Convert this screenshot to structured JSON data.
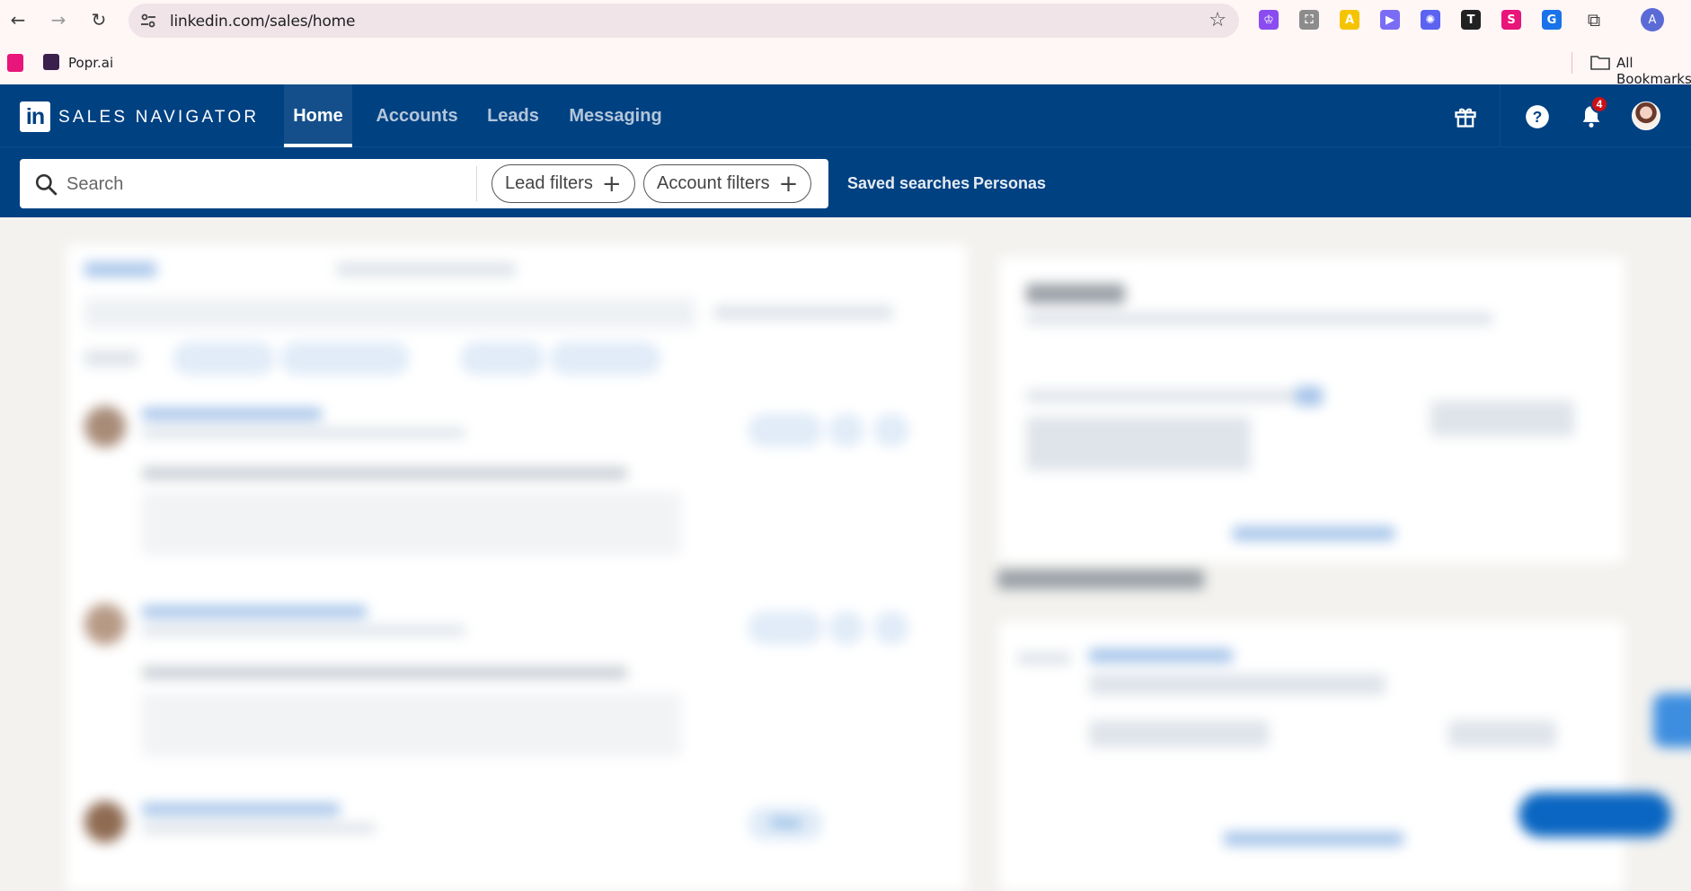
{
  "browser": {
    "url": "linkedin.com/sales/home",
    "bookmarks": [
      {
        "label": ""
      },
      {
        "label": "Popr.ai"
      }
    ],
    "all_bookmarks_label": "All Bookmarks",
    "profile_initial": "A",
    "extensions": [
      {
        "name": "purple-ext-icon",
        "color": "#8a4cf0",
        "glyph": "♔"
      },
      {
        "name": "gray-ext-icon",
        "color": "#8c8c8c",
        "glyph": "⛶"
      },
      {
        "name": "yellow-ext-icon",
        "color": "#f5c400",
        "glyph": "A"
      },
      {
        "name": "violet-ext-icon",
        "color": "#7b6cf5",
        "glyph": "▶"
      },
      {
        "name": "blue-burst-ext-icon",
        "color": "#5b63f0",
        "glyph": "✺"
      },
      {
        "name": "black-t-ext-icon",
        "color": "#222222",
        "glyph": "T"
      },
      {
        "name": "pink-ext-icon",
        "color": "#e8157a",
        "glyph": "S"
      },
      {
        "name": "blue-ext-icon",
        "color": "#1a73e8",
        "glyph": "G"
      }
    ]
  },
  "sales_navigator": {
    "brand": "SALES NAVIGATOR",
    "logo_text": "in",
    "nav": [
      {
        "label": "Home",
        "active": true
      },
      {
        "label": "Accounts",
        "active": false
      },
      {
        "label": "Leads",
        "active": false
      },
      {
        "label": "Messaging",
        "active": false
      }
    ],
    "notification_count": "4",
    "search": {
      "placeholder": "Search",
      "lead_filters_label": "Lead filters",
      "account_filters_label": "Account filters"
    },
    "links": {
      "saved_searches": "Saved searches",
      "personas": "Personas"
    }
  },
  "background_feed": {
    "visible_texts": [
      "View"
    ]
  }
}
